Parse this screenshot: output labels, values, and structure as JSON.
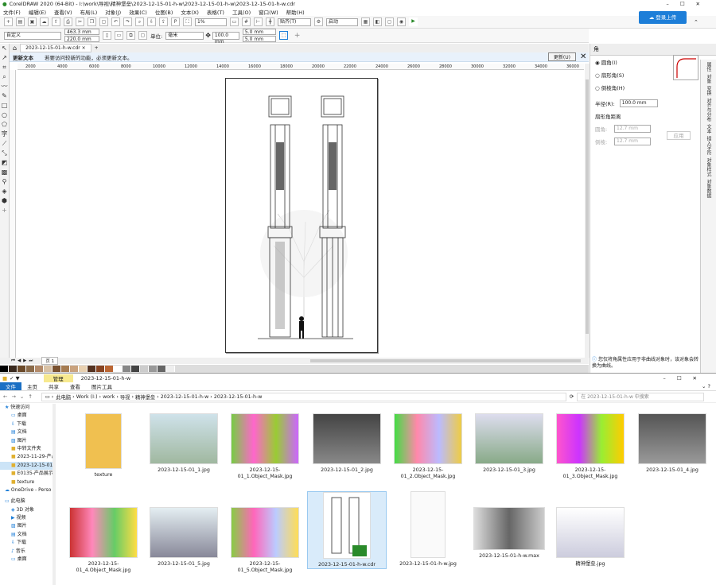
{
  "app": {
    "title": "CorelDRAW 2020 (64-Bit) - I:\\work\\导视\\精神堡垒\\2023-12-15-01-h-w\\2023-12-15-01-h-w\\2023-12-15-01-h-w.cdr",
    "upload": "登录上传"
  },
  "menu": [
    "文件(F)",
    "编辑(E)",
    "查看(V)",
    "布局(L)",
    "对象(J)",
    "效果(C)",
    "位图(B)",
    "文本(X)",
    "表格(T)",
    "工具(O)",
    "窗口(W)",
    "帮助(H)"
  ],
  "toolbar": {
    "zoom": "1%",
    "snap": "贴齐(T)",
    "launch": "启动"
  },
  "props": {
    "preset": "自定义",
    "w": "463.3 mm",
    "h": "220.0 mm",
    "unit_label": "单位:",
    "unit": "毫米",
    "nudge": "100.0 mm",
    "dupx": "5.0 mm",
    "dupy": "5.0 mm"
  },
  "doc_tab": "2023-12-15-01-h-w.cdr",
  "notice": {
    "title": "更新文本",
    "text": "若要访问较新的功能，必须更新文本。",
    "button": "更新(U)"
  },
  "ruler": [
    "2000",
    "4000",
    "6000",
    "8000",
    "10000",
    "12000",
    "14000",
    "16000",
    "18000",
    "20000",
    "22000",
    "24000",
    "26000",
    "28000",
    "30000",
    "32000",
    "34000",
    "36000"
  ],
  "status": {
    "page": "页 1"
  },
  "palette": [
    "#000000",
    "#3a2a1e",
    "#6b4a2a",
    "#8b6b4a",
    "#b38b6b",
    "#d9c2a6",
    "#7a5230",
    "#a67c52",
    "#c9a27e",
    "#e8d0b0",
    "#553322",
    "#884422",
    "#bb6633",
    "#ffffff",
    "#888888",
    "#444444",
    "#cccccc",
    "#999999",
    "#666666",
    "#eeeeee"
  ],
  "dock": {
    "title": "角",
    "options": [
      "圆角(I)",
      "扇形角(S)",
      "倒棱角(H)"
    ],
    "radius_label": "半径(R):",
    "radius": "100.0 mm",
    "edge_title": "扇形角距离",
    "edge1_label": "圆角:",
    "edge1": "12.7 mm",
    "edge2_label": "倒棱:",
    "edge2": "12.7 mm",
    "apply": "应用",
    "hint": "您仅将角属性应用于非曲线对象时，该对象会转换为曲线。"
  },
  "vtabs": [
    "属性",
    "对象",
    "变换",
    "对齐与分布",
    "文本",
    "插入字符",
    "对象样式",
    "对象数据"
  ],
  "explorer": {
    "title": "2023-12-15-01-h-w",
    "manage": "管理",
    "ribbon": [
      "文件",
      "主页",
      "共享",
      "查看",
      "图片工具"
    ],
    "path": [
      "此电脑",
      "Work (I:)",
      "work",
      "导视",
      "精神堡垒",
      "2023-12-15-01-h-w",
      "2023-12-15-01-h-w"
    ],
    "search": "在 2023-12-15-01-h-w 中搜索",
    "nav": [
      "快速访问",
      "桌面",
      "下载",
      "文档",
      "图片",
      "中转文件夹",
      "2023-11-29-产品",
      "2023-12-15-01",
      "E0135-产品展示",
      "texture",
      "OneDrive - Perso",
      "此电脑",
      "3D 对象",
      "视频",
      "图片",
      "文档",
      "下载",
      "音乐",
      "桌面"
    ],
    "files": [
      "texture",
      "2023-12-15-01_1.jpg",
      "2023-12-15-01_1.Object_Mask.jpg",
      "2023-12-15-01_2.jpg",
      "2023-12-15-01_2.Object_Mask.jpg",
      "2023-12-15-01_3.jpg",
      "2023-12-15-01_3.Object_Mask.jpg",
      "2023-12-15-01_4.jpg",
      "2023-12-15-01_4.Object_Mask.jpg",
      "2023-12-15-01_5.jpg",
      "2023-12-15-01_5.Object_Mask.jpg",
      "2023-12-15-01-h-w.cdr",
      "2023-12-15-01-h-w.jpg",
      "2023-12-15-01-h-w.max",
      "精神堡垒.jpg"
    ]
  }
}
